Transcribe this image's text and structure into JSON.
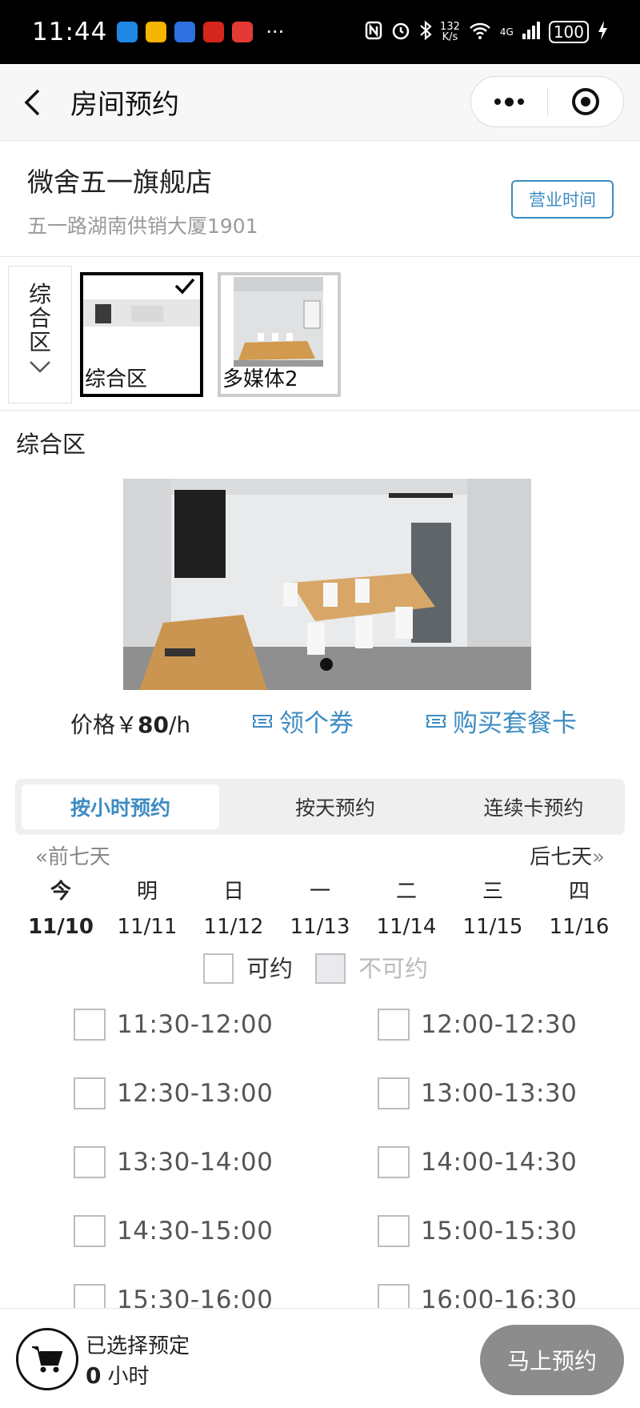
{
  "status_bar": {
    "time": "11:44",
    "net_speed": "132",
    "net_unit": "K/s",
    "network": "4G",
    "battery": "100"
  },
  "title_bar": {
    "title": "房间预约"
  },
  "store": {
    "name": "微舍五一旗舰店",
    "address": "五一路湖南供销大厦1901",
    "hours_button": "营业时间"
  },
  "area_selector": {
    "label": "综合区"
  },
  "rooms": [
    {
      "label": "综合区",
      "selected": true
    },
    {
      "label": "多媒体2",
      "selected": false
    }
  ],
  "section_title": "综合区",
  "price": {
    "prefix": "价格￥",
    "value": "80",
    "unit": "/h"
  },
  "actions": {
    "coupon": "领个券",
    "package": "购买套餐卡"
  },
  "tabs": [
    {
      "label": "按小时预约",
      "active": true
    },
    {
      "label": "按天预约",
      "active": false
    },
    {
      "label": "连续卡预约",
      "active": false
    }
  ],
  "week_nav": {
    "prev": "前七天",
    "next": "后七天"
  },
  "days": [
    {
      "weekday": "今",
      "date": "11/10",
      "selected": true
    },
    {
      "weekday": "明",
      "date": "11/11"
    },
    {
      "weekday": "日",
      "date": "11/12"
    },
    {
      "weekday": "一",
      "date": "11/13"
    },
    {
      "weekday": "二",
      "date": "11/14"
    },
    {
      "weekday": "三",
      "date": "11/15"
    },
    {
      "weekday": "四",
      "date": "11/16"
    }
  ],
  "legend": {
    "available": "可约",
    "unavailable": "不可约"
  },
  "slots": [
    "11:30-12:00",
    "12:00-12:30",
    "12:30-13:00",
    "13:00-13:30",
    "13:30-14:00",
    "14:00-14:30",
    "14:30-15:00",
    "15:00-15:30",
    "15:30-16:00",
    "16:00-16:30"
  ],
  "bottom_bar": {
    "selected_label": "已选择预定",
    "hours_value": "0",
    "hours_unit": "小时",
    "book_button": "马上预约"
  },
  "colors": {
    "accent": "#3d8cc2",
    "book_button": "#8c8c8c",
    "unavailable_box": "#e9e9ee"
  }
}
